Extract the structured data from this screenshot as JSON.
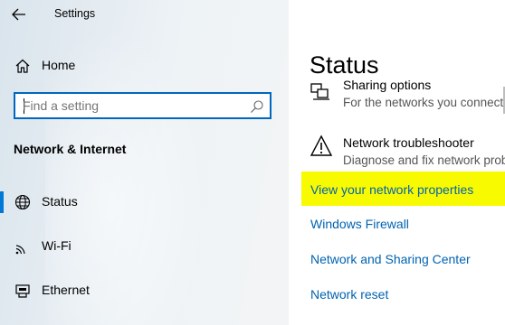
{
  "window": {
    "title": "Settings"
  },
  "sidebar": {
    "home_label": "Home",
    "search": {
      "placeholder": "Find a setting",
      "value": ""
    },
    "section_title": "Network & Internet",
    "items": [
      {
        "label": "Status",
        "icon": "globe-icon",
        "selected": true
      },
      {
        "label": "Wi-Fi",
        "icon": "wifi-icon",
        "selected": false
      },
      {
        "label": "Ethernet",
        "icon": "ethernet-icon",
        "selected": false
      }
    ]
  },
  "main": {
    "title": "Status",
    "sharing": {
      "title": "Sharing options",
      "subtitle": "For the networks you connect to"
    },
    "troubleshooter": {
      "title": "Network troubleshooter",
      "subtitle": "Diagnose and fix network problems"
    },
    "links": [
      {
        "label": "View your network properties",
        "highlighted": true
      },
      {
        "label": "Windows Firewall",
        "highlighted": false
      },
      {
        "label": "Network and Sharing Center",
        "highlighted": false
      },
      {
        "label": "Network reset",
        "highlighted": false
      }
    ]
  },
  "colors": {
    "accent": "#0078d7",
    "link": "#0063b1",
    "highlight": "#f8fb00"
  }
}
